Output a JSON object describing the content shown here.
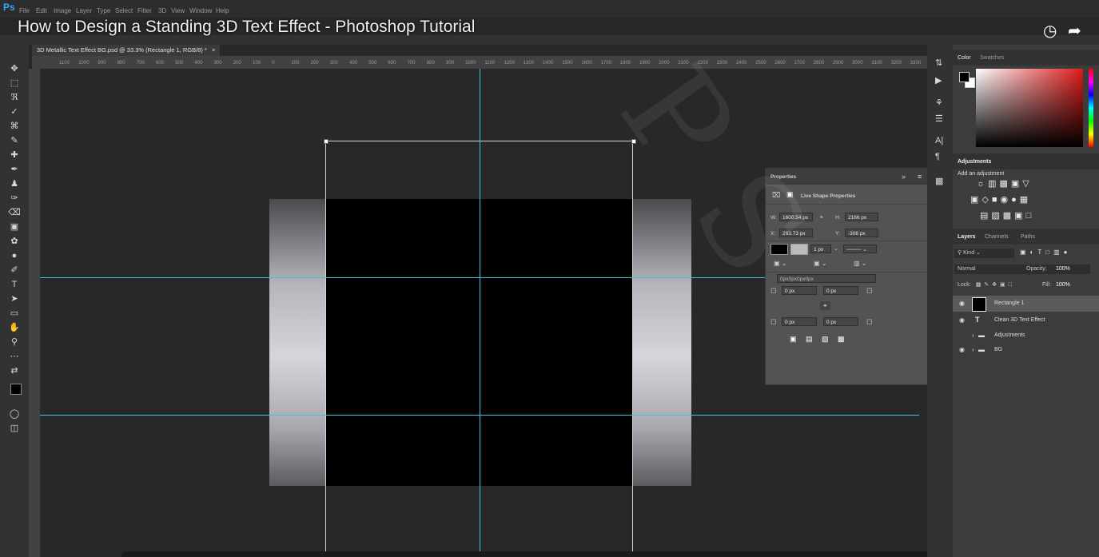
{
  "app": {
    "logo": "Ps",
    "menus": [
      "File",
      "Edit",
      "Image",
      "Layer",
      "Type",
      "Select",
      "Filter",
      "3D",
      "View",
      "Window",
      "Help"
    ]
  },
  "video_title": "How to Design a Standing 3D Text Effect - Photoshop Tutorial",
  "document_tab": {
    "label": "3D Metallic Text Effect BG.psd @ 33.3% (Rectangle 1, RGB/8) *",
    "close": "×"
  },
  "ruler_ticks": [
    "1100",
    "1000",
    "900",
    "800",
    "700",
    "600",
    "500",
    "400",
    "300",
    "200",
    "100",
    "0",
    "100",
    "200",
    "300",
    "400",
    "500",
    "600",
    "700",
    "800",
    "900",
    "1000",
    "1100",
    "1200",
    "1300",
    "1400",
    "1500",
    "1600",
    "1700",
    "1800",
    "1900",
    "2000",
    "2100",
    "2200",
    "2300",
    "2400",
    "2500",
    "2600",
    "2700",
    "2800",
    "2900",
    "3000",
    "3100",
    "3200",
    "3300"
  ],
  "properties": {
    "tab": "Properties",
    "section": "Live Shape Properties",
    "w_label": "W:",
    "w_value": "1600.54 px",
    "h_label": "H:",
    "h_value": "2166 px",
    "x_label": "X:",
    "x_value": "293.73 px",
    "y_label": "Y:",
    "y_value": "-306 px",
    "stroke_width": "1 px",
    "corner_all": "0px0px0px0px",
    "corner_tl": "0 px",
    "corner_tr": "0 px",
    "corner_bl": "0 px",
    "corner_br": "0 px"
  },
  "color_panel": {
    "tabs": [
      "Color",
      "Swatches"
    ]
  },
  "adjustments_panel": {
    "tab": "Adjustments",
    "hint": "Add an adjustment"
  },
  "layers_panel": {
    "tabs": [
      "Layers",
      "Channels",
      "Paths"
    ],
    "filter": "Kind",
    "blend_mode": "Normal",
    "opacity_label": "Opacity:",
    "opacity_value": "100%",
    "lock_label": "Lock:",
    "fill_label": "Fill:",
    "fill_value": "100%",
    "layers": [
      {
        "name": "Rectangle 1"
      },
      {
        "name": "Clean 3D Text Effect"
      },
      {
        "name": "Adjustments"
      },
      {
        "name": "BG"
      }
    ]
  },
  "colors": {
    "guide": "#3fc4d8",
    "foreground": "#000000",
    "background": "#ffffff",
    "accent": "#31a8ff"
  }
}
